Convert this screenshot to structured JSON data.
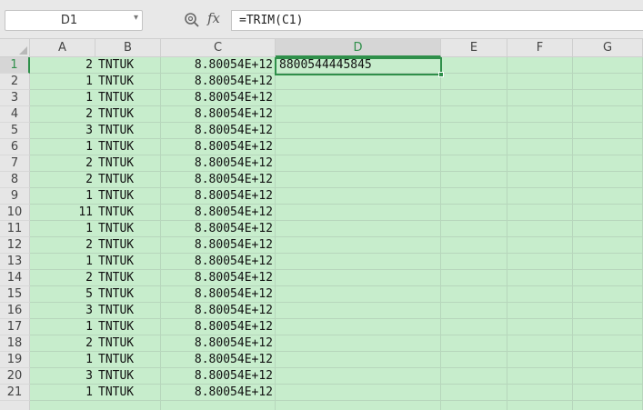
{
  "name_box": {
    "value": "D1"
  },
  "formula_bar": {
    "fx_label": "fx",
    "formula": "=TRIM(C1)"
  },
  "columns": [
    "A",
    "B",
    "C",
    "D",
    "E",
    "F",
    "G"
  ],
  "active_column": "D",
  "active_row": 1,
  "rows": [
    {
      "n": "1",
      "a": "2",
      "b": "TNTUK",
      "c": "8.80054E+12",
      "d": "8800544445845"
    },
    {
      "n": "2",
      "a": "1",
      "b": "TNTUK",
      "c": "8.80054E+12",
      "d": ""
    },
    {
      "n": "3",
      "a": "1",
      "b": "TNTUK",
      "c": "8.80054E+12",
      "d": ""
    },
    {
      "n": "4",
      "a": "2",
      "b": "TNTUK",
      "c": "8.80054E+12",
      "d": ""
    },
    {
      "n": "5",
      "a": "3",
      "b": "TNTUK",
      "c": "8.80054E+12",
      "d": ""
    },
    {
      "n": "6",
      "a": "1",
      "b": "TNTUK",
      "c": "8.80054E+12",
      "d": ""
    },
    {
      "n": "7",
      "a": "2",
      "b": "TNTUK",
      "c": "8.80054E+12",
      "d": ""
    },
    {
      "n": "8",
      "a": "2",
      "b": "TNTUK",
      "c": "8.80054E+12",
      "d": ""
    },
    {
      "n": "9",
      "a": "1",
      "b": "TNTUK",
      "c": "8.80054E+12",
      "d": ""
    },
    {
      "n": "10",
      "a": "11",
      "b": "TNTUK",
      "c": "8.80054E+12",
      "d": ""
    },
    {
      "n": "11",
      "a": "1",
      "b": "TNTUK",
      "c": "8.80054E+12",
      "d": ""
    },
    {
      "n": "12",
      "a": "2",
      "b": "TNTUK",
      "c": "8.80054E+12",
      "d": ""
    },
    {
      "n": "13",
      "a": "1",
      "b": "TNTUK",
      "c": "8.80054E+12",
      "d": ""
    },
    {
      "n": "14",
      "a": "2",
      "b": "TNTUK",
      "c": "8.80054E+12",
      "d": ""
    },
    {
      "n": "15",
      "a": "5",
      "b": "TNTUK",
      "c": "8.80054E+12",
      "d": ""
    },
    {
      "n": "16",
      "a": "3",
      "b": "TNTUK",
      "c": "8.80054E+12",
      "d": ""
    },
    {
      "n": "17",
      "a": "1",
      "b": "TNTUK",
      "c": "8.80054E+12",
      "d": ""
    },
    {
      "n": "18",
      "a": "2",
      "b": "TNTUK",
      "c": "8.80054E+12",
      "d": ""
    },
    {
      "n": "19",
      "a": "1",
      "b": "TNTUK",
      "c": "8.80054E+12",
      "d": ""
    },
    {
      "n": "20",
      "a": "3",
      "b": "TNTUK",
      "c": "8.80054E+12",
      "d": ""
    },
    {
      "n": "21",
      "a": "1",
      "b": "TNTUK",
      "c": "8.80054E+12",
      "d": ""
    }
  ],
  "colors": {
    "sheet_bg": "#c7edcc",
    "accent": "#2f8f4a"
  }
}
